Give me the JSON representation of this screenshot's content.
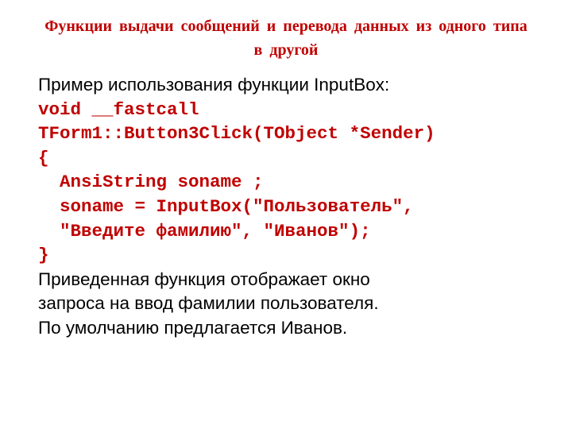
{
  "title": "Функции выдачи сообщений и перевода данных из одного типа в другой",
  "intro": "Пример использования функции InputBox:",
  "code": {
    "l1": "void __fastcall",
    "l2": "TForm1::Button3Click(TObject *Sender)",
    "l3": "{",
    "l4": "  AnsiString soname ;",
    "l5": "  soname = InputBox(\"Пользователь\",",
    "l6": "  \"Введите фамилию\", \"Иванов\");",
    "l7": "}"
  },
  "desc1": "Приведенная функция отображает окно",
  "desc2": "запроса на ввод фамилии пользователя.",
  "desc3": "По умолчанию предлагается Иванов."
}
